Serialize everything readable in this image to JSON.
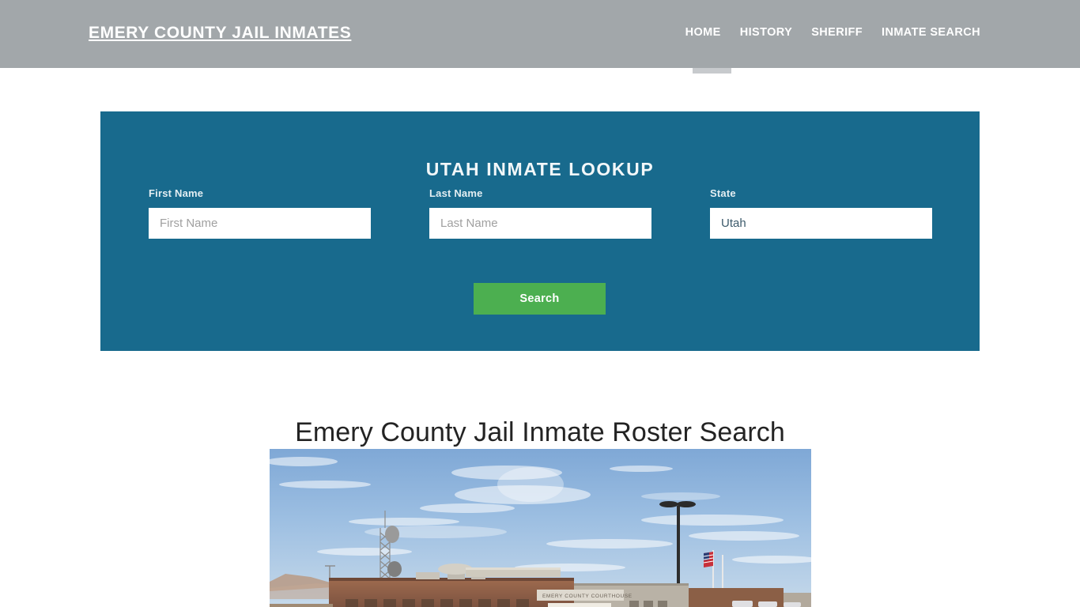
{
  "header": {
    "brand": "Emery County Jail Inmates",
    "brand_color": "#ffffff",
    "background_color": "#a2a7aa",
    "nav": [
      {
        "label": "Home",
        "active": true
      },
      {
        "label": "History",
        "active": false
      },
      {
        "label": "Sheriff",
        "active": false
      },
      {
        "label": "Inmate Search",
        "active": false
      }
    ],
    "indicator_color": "#c7cacd"
  },
  "lookup": {
    "title": "Utah Inmate Lookup",
    "panel_color": "#186a8d",
    "fields": [
      {
        "label": "First Name",
        "placeholder": "First Name",
        "value": ""
      },
      {
        "label": "Last Name",
        "placeholder": "Last Name",
        "value": ""
      },
      {
        "label": "State",
        "placeholder": "State",
        "value": "Utah"
      }
    ],
    "submit_label": "Search",
    "submit_color": "#4caf50"
  },
  "main": {
    "heading": "Emery County Jail Inmate Roster Search",
    "photo_alt": "Emery County Courthouse building with blue sky, communications tower, light pole and American flag",
    "photo_sign_text": "EMERY COUNTY COURTHOUSE"
  }
}
